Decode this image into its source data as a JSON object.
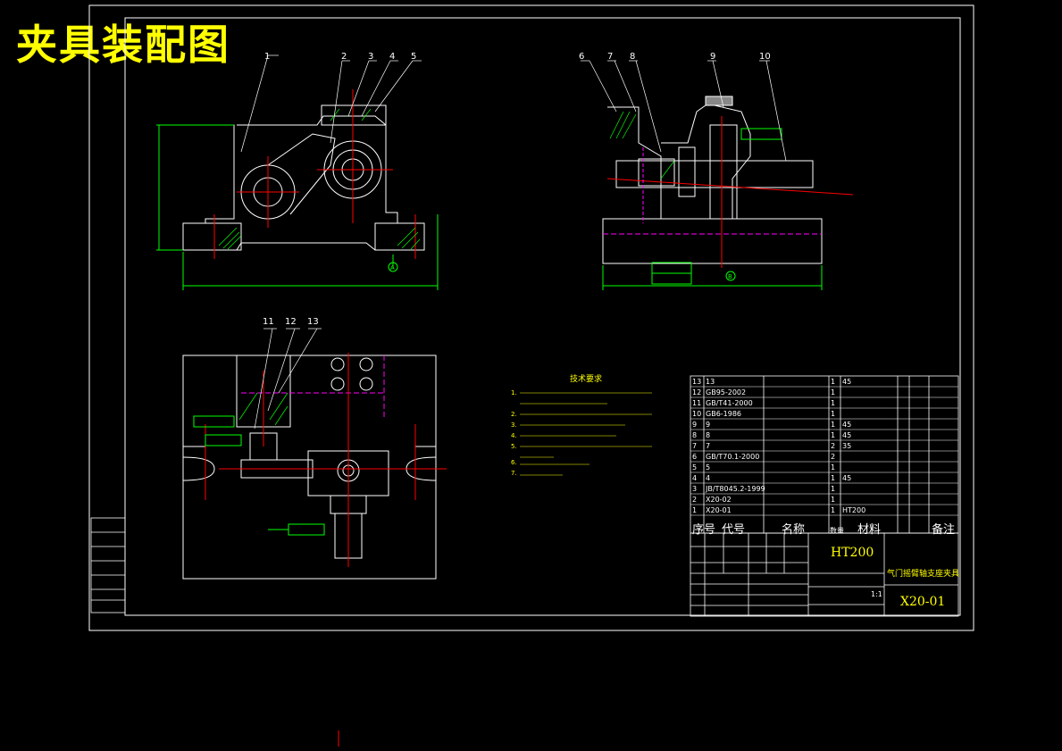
{
  "title": "夹具装配图",
  "views": {
    "front_balloons": [
      "1",
      "2",
      "3",
      "4",
      "5"
    ],
    "side_balloons": [
      "6",
      "7",
      "8",
      "9",
      "10"
    ],
    "top_balloons": [
      "11",
      "12",
      "13"
    ],
    "section_marks": [
      "A",
      "B"
    ]
  },
  "tech_requirements": {
    "heading": "技术要求",
    "items": [
      "1.",
      "2.",
      "3.",
      "4.",
      "5.",
      "6.",
      "7."
    ]
  },
  "bom": {
    "rows": [
      {
        "no": "13",
        "code": "13",
        "name": "",
        "qty": "1",
        "mat": "45",
        "note": ""
      },
      {
        "no": "12",
        "code": "GB95-2002",
        "name": "",
        "qty": "1",
        "mat": "",
        "note": ""
      },
      {
        "no": "11",
        "code": "GB/T41-2000",
        "name": "",
        "qty": "1",
        "mat": "",
        "note": ""
      },
      {
        "no": "10",
        "code": "GB6-1986",
        "name": "",
        "qty": "1",
        "mat": "",
        "note": ""
      },
      {
        "no": "9",
        "code": "9",
        "name": "",
        "qty": "1",
        "mat": "45",
        "note": ""
      },
      {
        "no": "8",
        "code": "8",
        "name": "",
        "qty": "1",
        "mat": "45",
        "note": ""
      },
      {
        "no": "7",
        "code": "7",
        "name": "",
        "qty": "2",
        "mat": "35",
        "note": ""
      },
      {
        "no": "6",
        "code": "GB/T70.1-2000",
        "name": "",
        "qty": "2",
        "mat": "",
        "note": ""
      },
      {
        "no": "5",
        "code": "5",
        "name": "",
        "qty": "1",
        "mat": "",
        "note": ""
      },
      {
        "no": "4",
        "code": "4",
        "name": "",
        "qty": "1",
        "mat": "45",
        "note": ""
      },
      {
        "no": "3",
        "code": "JB/T8045.2-1999",
        "name": "",
        "qty": "1",
        "mat": "",
        "note": ""
      },
      {
        "no": "2",
        "code": "X20-02",
        "name": "",
        "qty": "1",
        "mat": "",
        "note": ""
      },
      {
        "no": "1",
        "code": "X20-01",
        "name": "",
        "qty": "1",
        "mat": "HT200",
        "note": ""
      }
    ],
    "header": {
      "no": "序号",
      "code": "代号",
      "name": "名称",
      "qty": "数量",
      "mat": "材料",
      "note": "备注"
    }
  },
  "title_block": {
    "material": "HT200",
    "part_name": "气门摇臂轴支座夹具",
    "drawing_no": "X20-01",
    "scale": "1:1"
  }
}
